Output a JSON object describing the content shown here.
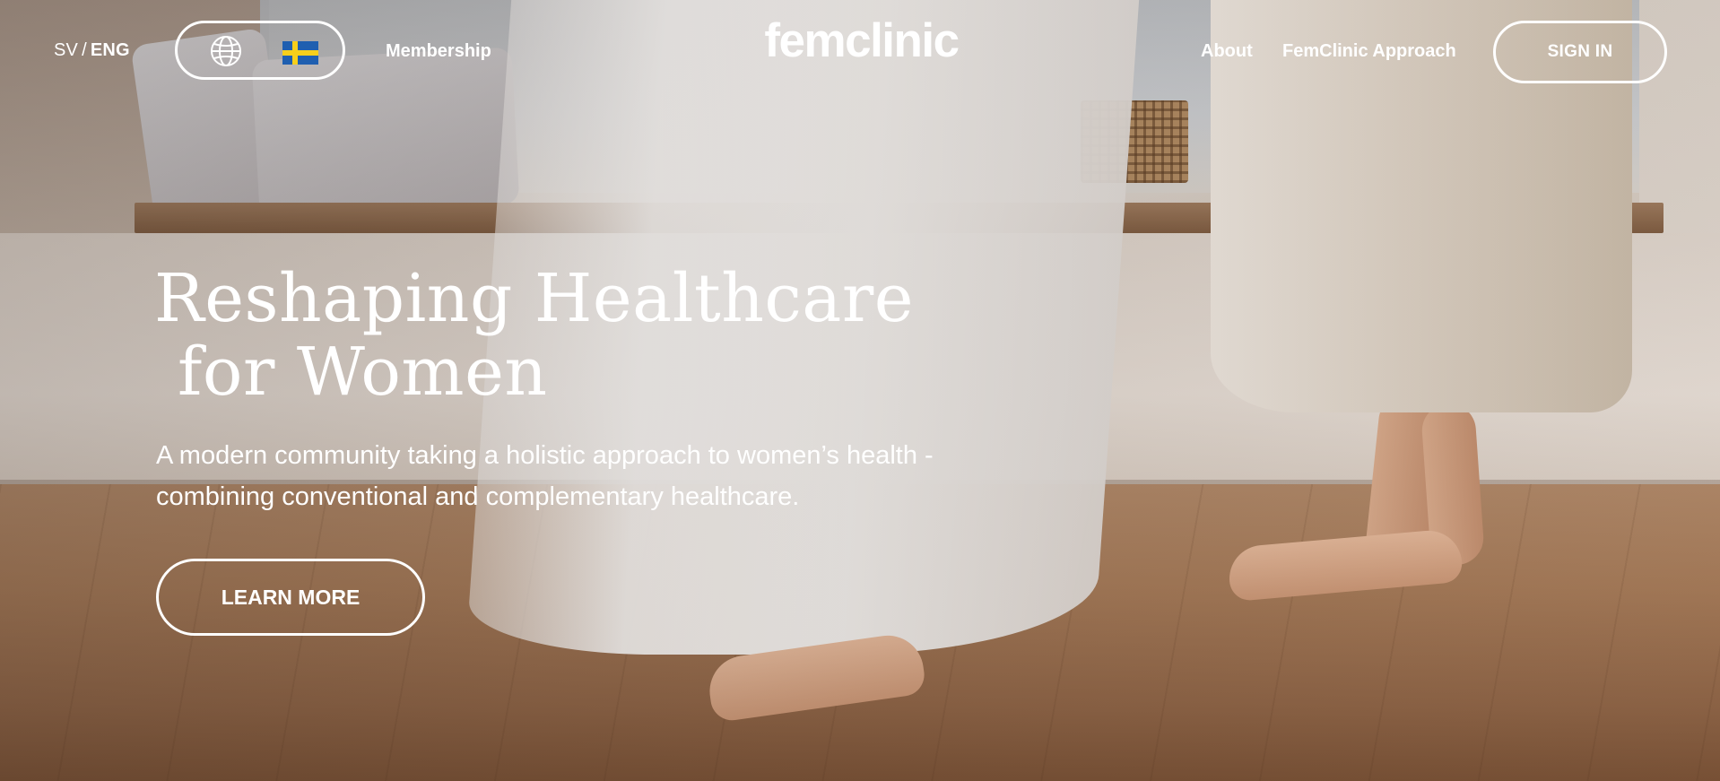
{
  "header": {
    "lang_sv": "SV",
    "lang_sep": "/",
    "lang_eng": "ENG",
    "membership": "Membership",
    "logo": "femclinic",
    "about": "About",
    "approach": "FemClinic Approach",
    "sign_in": "SIGN IN",
    "locale_icon": "globe-icon",
    "flag_icon": "sweden-flag-icon"
  },
  "hero": {
    "headline_line1": "Reshaping Healthcare",
    "headline_line2": "for Women",
    "subtitle": "A modern community taking a holistic approach to women’s health - combining conventional and complementary healthcare.",
    "cta": "LEARN MORE"
  },
  "colors": {
    "text": "#ffffff",
    "flag_blue": "#1f5fb0",
    "flag_yellow": "#f7cf1b"
  }
}
